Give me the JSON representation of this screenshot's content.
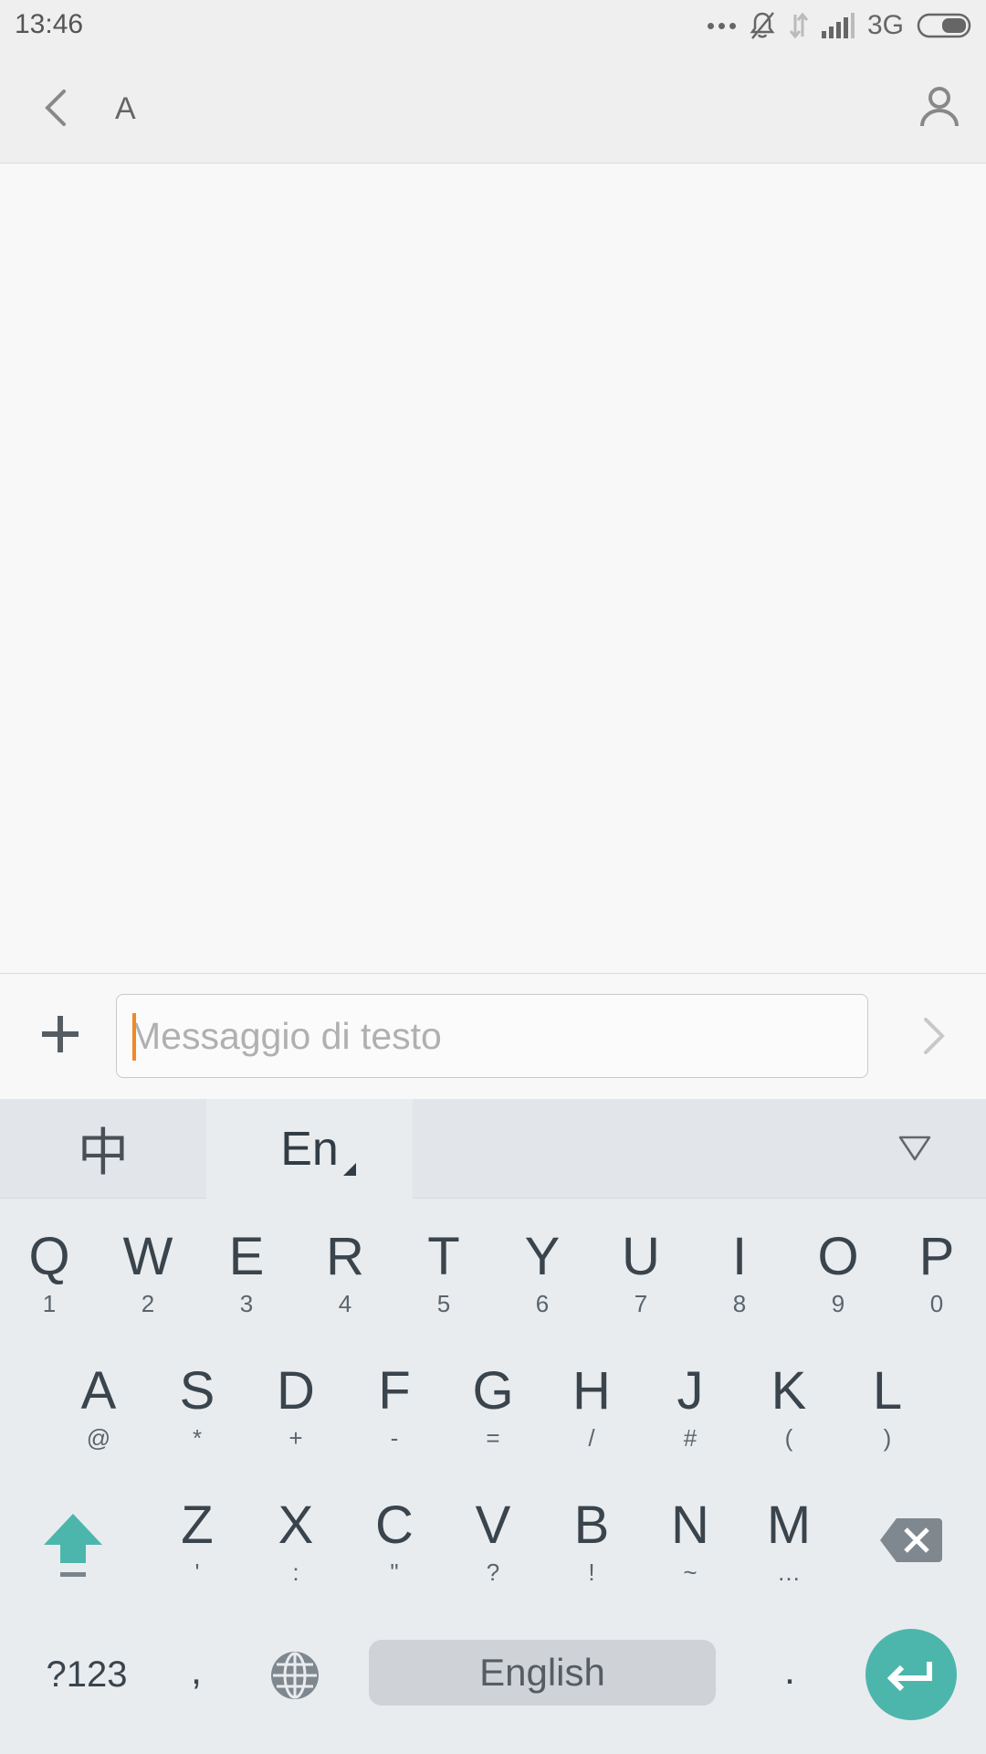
{
  "status_bar": {
    "time": "13:46",
    "network": "3G"
  },
  "top_bar": {
    "title": "A"
  },
  "compose": {
    "placeholder": "Messaggio di testo"
  },
  "keyboard": {
    "lang_chinese": "中",
    "lang_english": "En",
    "row1": [
      {
        "main": "Q",
        "sub": "1"
      },
      {
        "main": "W",
        "sub": "2"
      },
      {
        "main": "E",
        "sub": "3"
      },
      {
        "main": "R",
        "sub": "4"
      },
      {
        "main": "T",
        "sub": "5"
      },
      {
        "main": "Y",
        "sub": "6"
      },
      {
        "main": "U",
        "sub": "7"
      },
      {
        "main": "I",
        "sub": "8"
      },
      {
        "main": "O",
        "sub": "9"
      },
      {
        "main": "P",
        "sub": "0"
      }
    ],
    "row2": [
      {
        "main": "A",
        "sub": "@"
      },
      {
        "main": "S",
        "sub": "*"
      },
      {
        "main": "D",
        "sub": "+"
      },
      {
        "main": "F",
        "sub": "-"
      },
      {
        "main": "G",
        "sub": "="
      },
      {
        "main": "H",
        "sub": "/"
      },
      {
        "main": "J",
        "sub": "#"
      },
      {
        "main": "K",
        "sub": "("
      },
      {
        "main": "L",
        "sub": ")"
      }
    ],
    "row3": [
      {
        "main": "Z",
        "sub": "'"
      },
      {
        "main": "X",
        "sub": ":"
      },
      {
        "main": "C",
        "sub": "\""
      },
      {
        "main": "V",
        "sub": "?"
      },
      {
        "main": "B",
        "sub": "!"
      },
      {
        "main": "N",
        "sub": "~"
      },
      {
        "main": "M",
        "sub": "…"
      }
    ],
    "sym_label": "?123",
    "comma": ",",
    "space_label": "English",
    "period": "."
  },
  "colors": {
    "accent": "#4db6ac",
    "caret": "#f08a24"
  }
}
